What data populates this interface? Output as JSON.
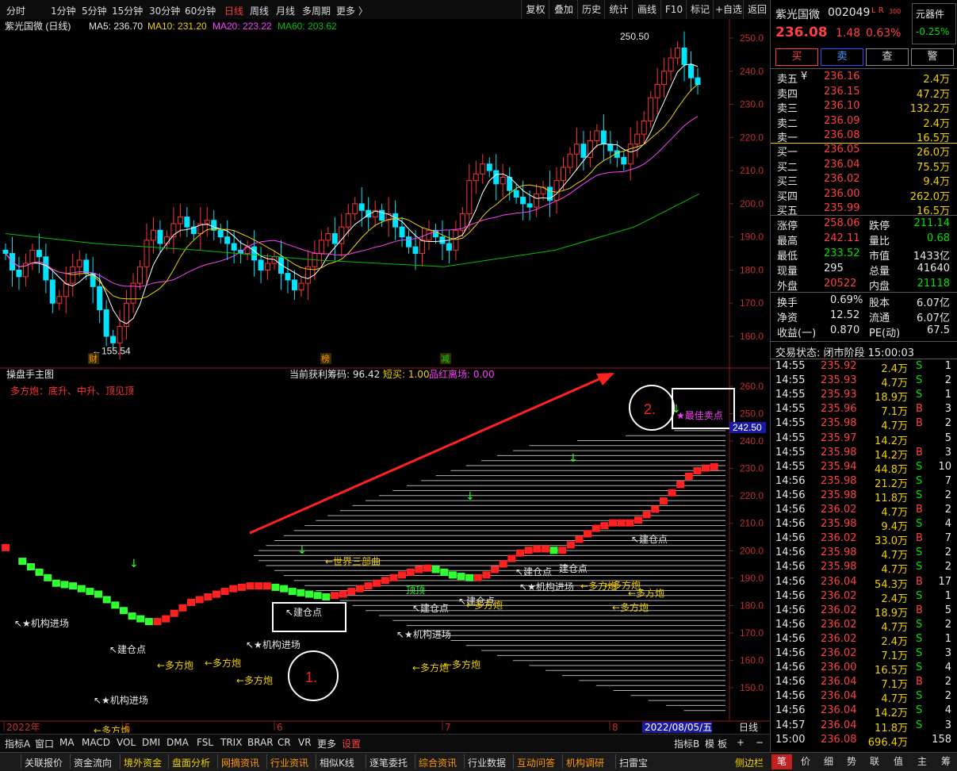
{
  "toolbar": {
    "periods": [
      "分时",
      "1分钟",
      "5分钟",
      "15分钟",
      "30分钟",
      "60分钟",
      "日线",
      "周线",
      "月线",
      "多周期",
      "更多 〉"
    ],
    "active_period": "日线",
    "right_buttons": [
      "复权",
      "叠加",
      "历史",
      "统计",
      "画线",
      "F10",
      "标记",
      "+自选",
      "返回"
    ]
  },
  "main_chart": {
    "stock_label": "紫光国微 (日线)",
    "ma5": "MA5: 236.70",
    "ma10": "MA10: 231.20",
    "ma20": "MA20: 223.22",
    "ma60": "MA60: 203.62",
    "high_note": "250.50",
    "low_note": "←155.54",
    "markers": [
      "财",
      "榜",
      "减"
    ],
    "y_ticks": [
      "250.0",
      "240.0",
      "230.0",
      "220.0",
      "210.0",
      "200.0",
      "190.0",
      "180.0",
      "170.0",
      "160.0"
    ],
    "colors": {
      "ma5": "#ffffff",
      "ma10": "#f0d000",
      "ma20": "#ff40ff",
      "ma60": "#00c000",
      "up": "#ff3333",
      "down": "#00e5ff"
    }
  },
  "sub_chart": {
    "title": "操盘手主图",
    "stats": "当前获利筹码: 96.42",
    "short_buy": "短买: 1.00",
    "exit": "品红离场: 0.00",
    "legend": "多方炮：底升、中升、顶见顶",
    "y_ticks": [
      "260.0",
      "250.0",
      "240.0",
      "230.0",
      "220.0",
      "210.0",
      "200.0",
      "190.0",
      "180.0",
      "170.0",
      "160.0",
      "150.0"
    ],
    "current_price_tag": "242.50",
    "best_sell": "★最佳卖点",
    "annotations": {
      "institution_in": "↖★机构进场",
      "build_position": "↖建仓点",
      "duoFang": "←多方炮",
      "wave": "←世界三部曲",
      "top": "顶顶",
      "build_position_plain": "建仓点"
    },
    "circle_1": "1.",
    "circle_2": "2."
  },
  "x_axis": {
    "labels": [
      "2022年",
      "5",
      "6",
      "7",
      "8"
    ],
    "date_tag": "2022/08/05/五",
    "period": "日线"
  },
  "indicator_tabs": [
    "指标A",
    "窗口",
    "MA",
    "MACD",
    "VOL",
    "DMI",
    "DMA",
    "FSL",
    "TRIX",
    "BRAR",
    "CR",
    "VR",
    "更多",
    "设置"
  ],
  "indicator_right": [
    "指标B",
    "模",
    "板",
    "+",
    "−"
  ],
  "quote": {
    "name": "紫光国微",
    "code": "002049",
    "flags": "L R",
    "flag_num": "300",
    "sector": "元器件",
    "sector_change": "-0.25%",
    "price": "236.08",
    "change": "1.48",
    "change_pct": "0.63%",
    "actions": [
      "买",
      "卖",
      "查",
      "警"
    ],
    "asks": [
      {
        "label": "卖五",
        "price": "236.16",
        "vol": "2.4万",
        "mark": "¥"
      },
      {
        "label": "卖四",
        "price": "236.15",
        "vol": "47.2万",
        "mark": ""
      },
      {
        "label": "卖三",
        "price": "236.10",
        "vol": "132.2万",
        "mark": ""
      },
      {
        "label": "卖二",
        "price": "236.09",
        "vol": "2.4万",
        "mark": ""
      },
      {
        "label": "卖一",
        "price": "236.08",
        "vol": "16.5万",
        "mark": ""
      }
    ],
    "bids": [
      {
        "label": "买一",
        "price": "236.05",
        "vol": "26.0万"
      },
      {
        "label": "买二",
        "price": "236.04",
        "vol": "75.5万"
      },
      {
        "label": "买三",
        "price": "236.02",
        "vol": "9.4万"
      },
      {
        "label": "买四",
        "price": "236.00",
        "vol": "262.0万"
      },
      {
        "label": "买五",
        "price": "235.99",
        "vol": "16.5万"
      }
    ],
    "stats_a": [
      {
        "k1": "涨停",
        "v1": "258.06",
        "c1": "red",
        "k2": "跌停",
        "v2": "211.14",
        "c2": "green"
      },
      {
        "k1": "最高",
        "v1": "242.11",
        "c1": "red",
        "k2": "量比",
        "v2": "0.68",
        "c2": "green"
      },
      {
        "k1": "最低",
        "v1": "233.52",
        "c1": "green",
        "k2": "市值",
        "v2": "1433亿",
        "c2": "white"
      },
      {
        "k1": "现量",
        "v1": "295",
        "c1": "white",
        "k2": "总量",
        "v2": "41640",
        "c2": "white"
      },
      {
        "k1": "外盘",
        "v1": "20522",
        "c1": "red",
        "k2": "内盘",
        "v2": "21118",
        "c2": "green"
      }
    ],
    "stats_b": [
      {
        "k1": "换手",
        "v1": "0.69%",
        "k2": "股本",
        "v2": "6.07亿"
      },
      {
        "k1": "净资",
        "v1": "12.52",
        "k2": "流通",
        "v2": "6.07亿"
      },
      {
        "k1": "收益(一)",
        "v1": "0.870",
        "k2": "PE(动)",
        "v2": "67.5"
      }
    ],
    "trade_status": "交易状态: 闭市阶段 15:00:03"
  },
  "ticks": [
    {
      "t": "14:55",
      "p": "235.92",
      "v": "2.4万",
      "d": "S",
      "n": "1"
    },
    {
      "t": "14:55",
      "p": "235.93",
      "v": "4.7万",
      "d": "S",
      "n": "2"
    },
    {
      "t": "14:55",
      "p": "235.93",
      "v": "18.9万",
      "d": "S",
      "n": "1"
    },
    {
      "t": "14:55",
      "p": "235.96",
      "v": "7.1万",
      "d": "B",
      "n": "3"
    },
    {
      "t": "14:55",
      "p": "235.98",
      "v": "4.7万",
      "d": "B",
      "n": "2"
    },
    {
      "t": "14:55",
      "p": "235.97",
      "v": "14.2万",
      "d": "",
      "n": "5"
    },
    {
      "t": "14:55",
      "p": "235.98",
      "v": "14.2万",
      "d": "B",
      "n": "3"
    },
    {
      "t": "14:55",
      "p": "235.94",
      "v": "44.8万",
      "d": "S",
      "n": "10"
    },
    {
      "t": "14:56",
      "p": "235.98",
      "v": "21.2万",
      "d": "S",
      "n": "7"
    },
    {
      "t": "14:56",
      "p": "235.98",
      "v": "11.8万",
      "d": "S",
      "n": "2"
    },
    {
      "t": "14:56",
      "p": "236.02",
      "v": "4.7万",
      "d": "B",
      "n": "2"
    },
    {
      "t": "14:56",
      "p": "235.98",
      "v": "9.4万",
      "d": "S",
      "n": "4"
    },
    {
      "t": "14:56",
      "p": "236.02",
      "v": "33.0万",
      "d": "B",
      "n": "7"
    },
    {
      "t": "14:56",
      "p": "235.98",
      "v": "4.7万",
      "d": "S",
      "n": "2"
    },
    {
      "t": "14:56",
      "p": "235.98",
      "v": "4.7万",
      "d": "S",
      "n": "2"
    },
    {
      "t": "14:56",
      "p": "236.04",
      "v": "54.3万",
      "d": "B",
      "n": "17"
    },
    {
      "t": "14:56",
      "p": "236.02",
      "v": "2.4万",
      "d": "S",
      "n": "1"
    },
    {
      "t": "14:56",
      "p": "236.02",
      "v": "18.9万",
      "d": "B",
      "n": "5"
    },
    {
      "t": "14:56",
      "p": "236.02",
      "v": "4.7万",
      "d": "S",
      "n": "2"
    },
    {
      "t": "14:56",
      "p": "236.02",
      "v": "2.4万",
      "d": "S",
      "n": "1"
    },
    {
      "t": "14:56",
      "p": "236.02",
      "v": "7.1万",
      "d": "S",
      "n": "3"
    },
    {
      "t": "14:56",
      "p": "236.00",
      "v": "16.5万",
      "d": "S",
      "n": "4"
    },
    {
      "t": "14:56",
      "p": "236.04",
      "v": "7.1万",
      "d": "B",
      "n": "2"
    },
    {
      "t": "14:56",
      "p": "236.04",
      "v": "4.7万",
      "d": "S",
      "n": "2"
    },
    {
      "t": "14:56",
      "p": "236.04",
      "v": "14.2万",
      "d": "S",
      "n": "4"
    },
    {
      "t": "14:57",
      "p": "236.04",
      "v": "11.8万",
      "d": "S",
      "n": "3"
    },
    {
      "t": "15:00",
      "p": "236.08",
      "v": "696.4万",
      "d": "",
      "n": "158"
    }
  ],
  "statusbar": {
    "left": [
      "关联报价",
      "资金流向",
      "境外资金",
      "盘面分析",
      "网摘资讯",
      "行业资讯",
      "相似K线",
      "逐笔委托",
      "综合资讯",
      "行业数据",
      "互动问答",
      "机构调研",
      "扫雷宝"
    ],
    "right_label": "侧边栏",
    "right_tabs": [
      "笔",
      "价",
      "细",
      "势",
      "联",
      "值",
      "主",
      "筹"
    ]
  }
}
